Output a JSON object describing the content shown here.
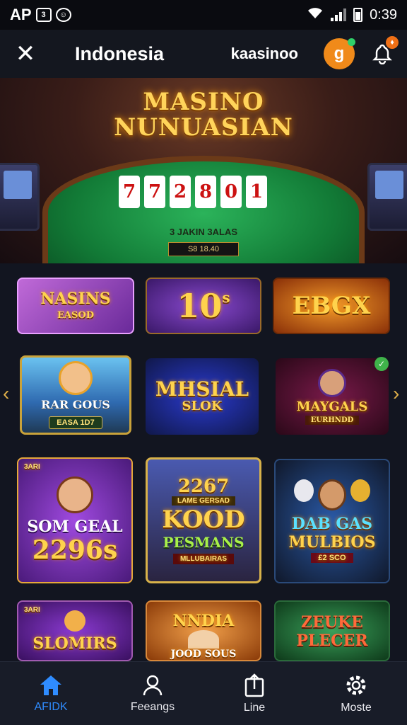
{
  "status_bar": {
    "carrier": "AP",
    "time": "0:39"
  },
  "header": {
    "title": "Indonesia",
    "brand": "kaasinoo",
    "avatar_letter": "g"
  },
  "hero": {
    "title_line1": "MASINO",
    "title_line2": "NUNUASIAN",
    "cards": [
      "7",
      "7",
      "2",
      "8",
      "0",
      "1"
    ],
    "subtitle": "3 JAKIN  3ALAS",
    "plate": "S8 18.40"
  },
  "row1": [
    {
      "l1": "NASINS",
      "l2": "EASOD"
    },
    {
      "l1": "10",
      "sup": "s"
    },
    {
      "l1": "EBGX"
    }
  ],
  "row2": [
    {
      "l1": "RAR GOUS",
      "plate": "EASA 1D7"
    },
    {
      "l1": "MHSIAL",
      "l2": "SLOK"
    },
    {
      "l1": "MAYGALS",
      "plate": "EURHNDD"
    }
  ],
  "row3": [
    {
      "corner": "3ARI",
      "l1": "SOM GEAL",
      "l2": "2296s"
    },
    {
      "l1": "2267",
      "sub": "LAME GERSAD",
      "l2": "KOOD",
      "l3": "PESMANS",
      "plate": "MLLUBAIRAS"
    },
    {
      "l1": "DAB GAS",
      "l2": "MULBIOS",
      "plate": "£2 SCO"
    }
  ],
  "row4": [
    {
      "corner": "3ARI",
      "l1": "SLOMIRS"
    },
    {
      "l1": "NNDIA",
      "l2": "JOOD SOUS"
    },
    {
      "l1": "ZEUKE",
      "l2": "PLECER"
    }
  ],
  "nav": [
    {
      "label": "AFIDK",
      "icon": "home-icon"
    },
    {
      "label": "Feeangs",
      "icon": "user-icon"
    },
    {
      "label": "Line",
      "icon": "share-icon"
    },
    {
      "label": "Moste",
      "icon": "settings-icon"
    }
  ],
  "colors": {
    "accent": "#2f8cff",
    "gold": "#ffd34d",
    "avatar": "#f08a1a"
  }
}
